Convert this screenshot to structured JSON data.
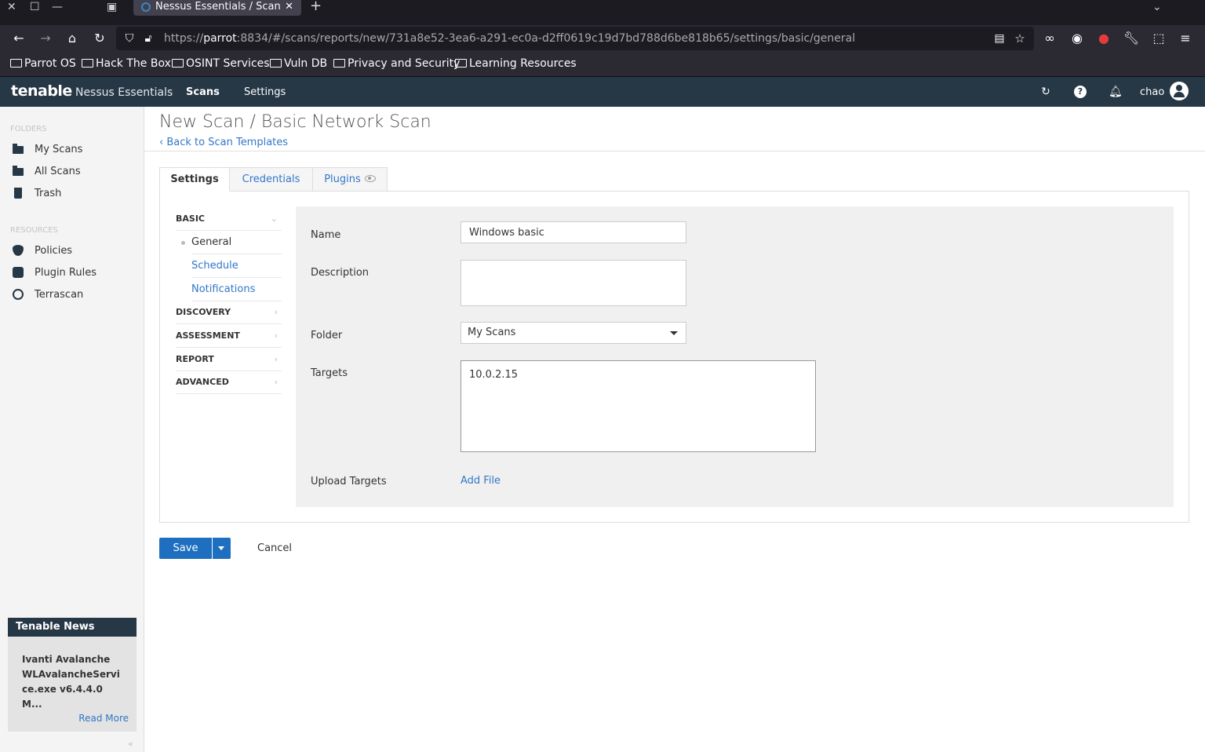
{
  "browser": {
    "tab_title": "Nessus Essentials / Scans",
    "url_host": "parrot",
    "url_prefix": "https://",
    "url_rest": ":8834/#/scans/reports/new/731a8e52-3ea6-a291-ec0a-d2ff0619c19d7bd788d6be818b65/settings/basic/general",
    "bookmarks": [
      "Parrot OS",
      "Hack The Box",
      "OSINT Services",
      "Vuln DB",
      "Privacy and Security",
      "Learning Resources"
    ]
  },
  "app": {
    "brand": "tenable",
    "product": "Nessus Essentials",
    "nav": {
      "scans": "Scans",
      "settings": "Settings"
    },
    "user": "chao"
  },
  "sidebar": {
    "folders_label": "FOLDERS",
    "folders": [
      "My Scans",
      "All Scans",
      "Trash"
    ],
    "resources_label": "RESOURCES",
    "resources": [
      "Policies",
      "Plugin Rules",
      "Terrascan"
    ],
    "news": {
      "title": "Tenable News",
      "headline": "Ivanti Avalanche WLAvalancheService.exe v6.4.4.0 M...",
      "read_more": "Read More"
    },
    "collapse": "«"
  },
  "page": {
    "title": "New Scan / Basic Network Scan",
    "back": "Back to Scan Templates",
    "tabs": [
      "Settings",
      "Credentials",
      "Plugins"
    ]
  },
  "settings_menu": {
    "basic": "BASIC",
    "basic_items": [
      "General",
      "Schedule",
      "Notifications"
    ],
    "discovery": "DISCOVERY",
    "assessment": "ASSESSMENT",
    "report": "REPORT",
    "advanced": "ADVANCED"
  },
  "form": {
    "name_label": "Name",
    "name_value": "Windows basic",
    "description_label": "Description",
    "description_value": "",
    "folder_label": "Folder",
    "folder_value": "My Scans",
    "targets_label": "Targets",
    "targets_value": "10.0.2.15",
    "upload_label": "Upload Targets",
    "add_file": "Add File"
  },
  "actions": {
    "save": "Save",
    "cancel": "Cancel"
  },
  "colors": {
    "header": "#263746",
    "link": "#3277c9",
    "primary_button": "#1e6fbf"
  }
}
